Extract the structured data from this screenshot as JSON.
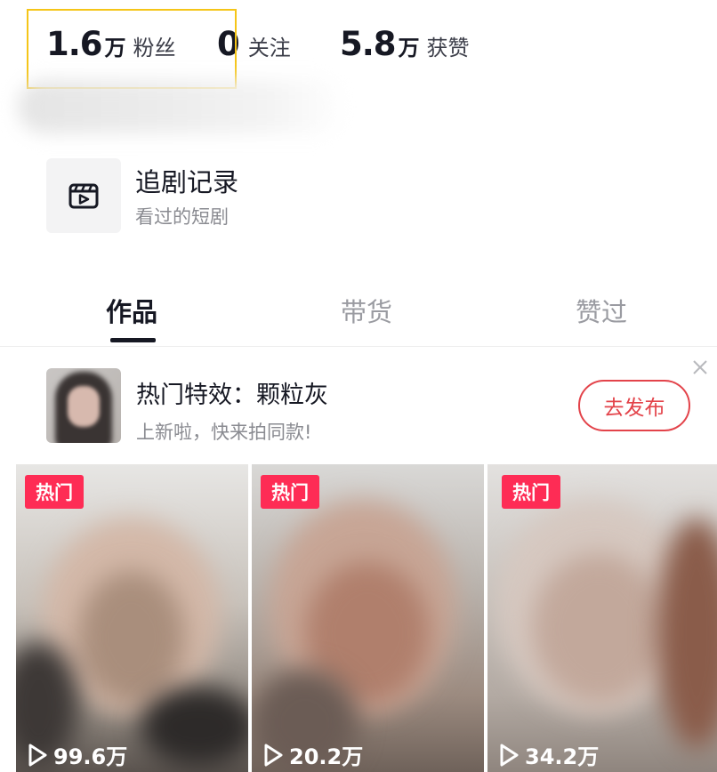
{
  "stats": {
    "fans": {
      "value": "1.6",
      "unit": "万",
      "label": "粉丝"
    },
    "following": {
      "value": "0",
      "label": "关注"
    },
    "likes": {
      "value": "5.8",
      "unit": "万",
      "label": "获赞"
    }
  },
  "drama_record": {
    "icon": "clapperboard-play-icon",
    "title": "追剧记录",
    "subtitle": "看过的短剧"
  },
  "tabs": [
    {
      "label": "作品",
      "active": true
    },
    {
      "label": "带货",
      "active": false
    },
    {
      "label": "赞过",
      "active": false
    }
  ],
  "effect_banner": {
    "title": "热门特效：颗粒灰",
    "subtitle": "上新啦，快来拍同款!",
    "button_label": "去发布",
    "close_icon": "close-icon"
  },
  "videos": [
    {
      "badge": "热门",
      "plays": "99.6万"
    },
    {
      "badge": "热门",
      "plays": "20.2万"
    },
    {
      "badge": "热门",
      "plays": "34.2万"
    }
  ],
  "colors": {
    "accent_red": "#fe2c55",
    "button_red": "#e3434a",
    "highlight_yellow": "#f5c518"
  }
}
